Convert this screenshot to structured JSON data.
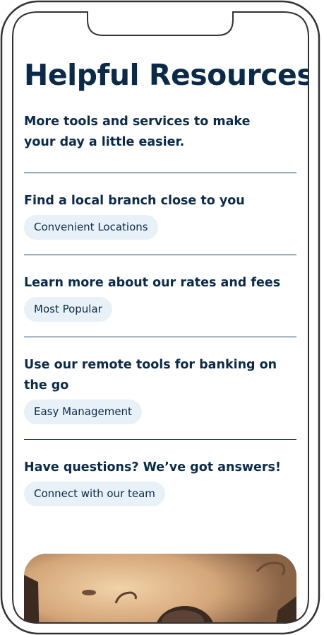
{
  "page": {
    "title": "Helpful Resources",
    "subtitle": "More tools and services to make your day a little easier."
  },
  "resources": [
    {
      "heading": "Find a local branch close to you",
      "link_label": "Convenient Locations"
    },
    {
      "heading": "Learn more about our rates and fees",
      "link_label": "Most Popular"
    },
    {
      "heading": "Use our remote tools for banking on the go",
      "link_label": "Easy Management"
    },
    {
      "heading": "Have questions? We’ve got answers!",
      "link_label": "Connect with our team"
    }
  ],
  "colors": {
    "text_navy": "#0b2a4a",
    "divider": "#1d3f62",
    "pill_background": "#e8f1f8",
    "frame_stroke": "#333333"
  },
  "icons": {
    "device": "phone-frame-icon"
  }
}
